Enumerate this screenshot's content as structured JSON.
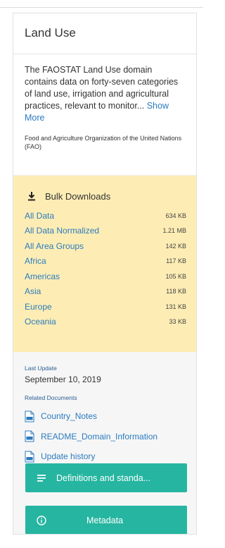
{
  "panel": {
    "title": "Land Use",
    "description": "The FAOSTAT Land Use domain contains data on forty-seven categories of land use, irrigation and agricultural practices, relevant to monitor...",
    "show_more": "Show More",
    "organization": "Food and Agriculture Organization of the United Nations (FAO)"
  },
  "downloads": {
    "title": "Bulk Downloads",
    "icon": "download-icon",
    "items": [
      {
        "name": "All Data",
        "size": "634 KB"
      },
      {
        "name": "All Data Normalized",
        "size": "1.21 MB"
      },
      {
        "name": "All Area Groups",
        "size": "142 KB"
      },
      {
        "name": "Africa",
        "size": "117 KB"
      },
      {
        "name": "Americas",
        "size": "105 KB"
      },
      {
        "name": "Asia",
        "size": "118 KB"
      },
      {
        "name": "Europe",
        "size": "131 KB"
      },
      {
        "name": "Oceania",
        "size": "33 KB"
      }
    ]
  },
  "last_update": {
    "label": "Last Update",
    "value": "September 10, 2019"
  },
  "related": {
    "label": "Related Documents",
    "icon": "pdf-file-icon",
    "items": [
      {
        "name": "Country_Notes"
      },
      {
        "name": "README_Domain_Information"
      },
      {
        "name": "Update history"
      }
    ]
  },
  "buttons": {
    "definitions": {
      "label": "Definitions and standa...",
      "icon": "list-icon"
    },
    "metadata": {
      "label": "Metadata",
      "icon": "info-icon"
    }
  },
  "colors": {
    "accent": "#26b5a1",
    "link": "#2b7bbf",
    "downloads_bg": "#fdedb4",
    "panel_bg": "#f6f6f6"
  }
}
